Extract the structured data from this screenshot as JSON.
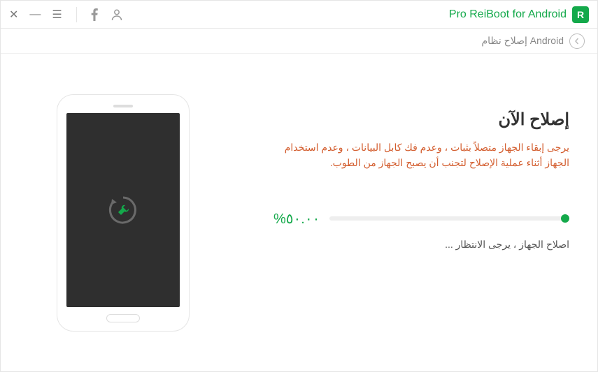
{
  "titlebar": {
    "app_name": "Pro ReiBoot for Android",
    "logo_letter": "R"
  },
  "breadcrumb": {
    "label": "إصلاح نظام Android"
  },
  "main": {
    "title": "إصلاح الآن",
    "warning": "يرجى إبقاء الجهاز متصلاً بثبات ، وعدم فك كابل البيانات ، وعدم استخدام الجهاز أثناء عملية الإصلاح لتجنب أن يصبح الجهاز من الطوب.",
    "percent": "٥٠.٠٠%",
    "status": "اصلاح الجهاز ، يرجى الانتظار ..."
  }
}
